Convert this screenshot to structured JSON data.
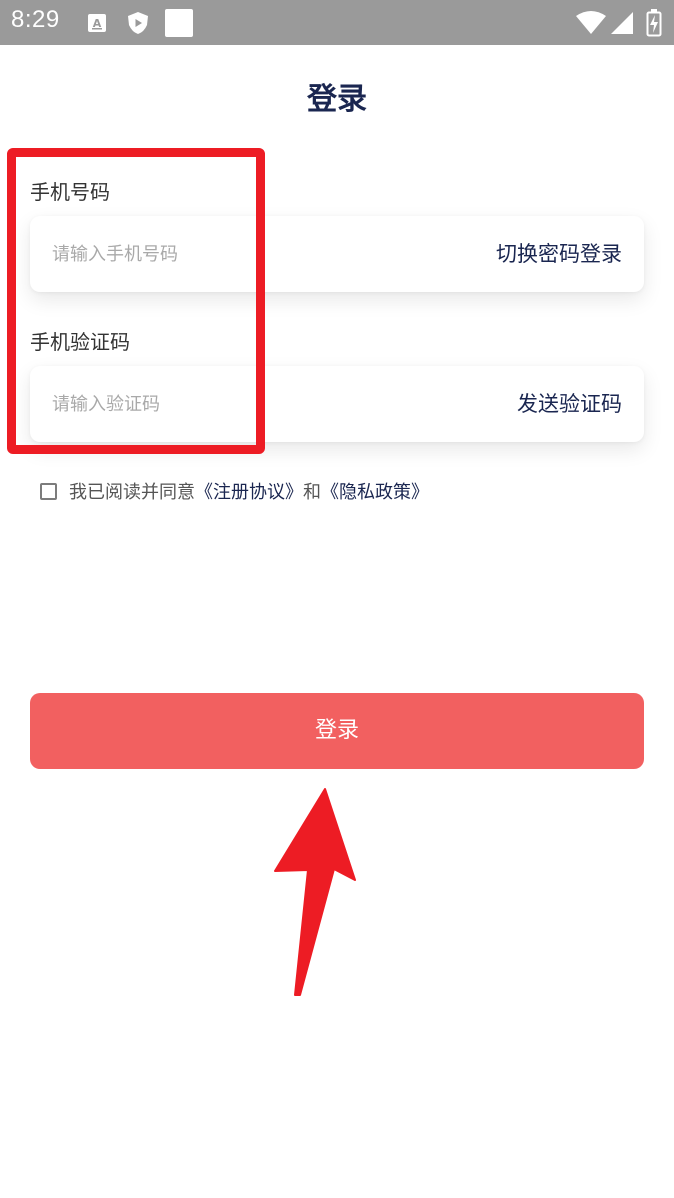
{
  "statusbar": {
    "time": "8:29",
    "left_icons": [
      "a-keyboard-icon",
      "shield-play-icon",
      "square-notification-icon"
    ],
    "right_icons": [
      "wifi-icon",
      "signal-icon",
      "battery-charging-icon"
    ]
  },
  "page": {
    "title": "登录"
  },
  "phone": {
    "label": "手机号码",
    "placeholder": "请输入手机号码",
    "action": "切换密码登录"
  },
  "code": {
    "label": "手机验证码",
    "placeholder": "请输入验证码",
    "action": "发送验证码"
  },
  "agreement": {
    "checked": false,
    "prefix": "我已阅读并同意",
    "terms_link": "《注册协议》",
    "conjunction": "和",
    "privacy_link": "《隐私政策》"
  },
  "login_button": {
    "label": "登录"
  },
  "colors": {
    "title": "#1a2650",
    "button": "#f26060",
    "annotation": "#ed1c24",
    "statusbar": "#9a9a9a"
  }
}
